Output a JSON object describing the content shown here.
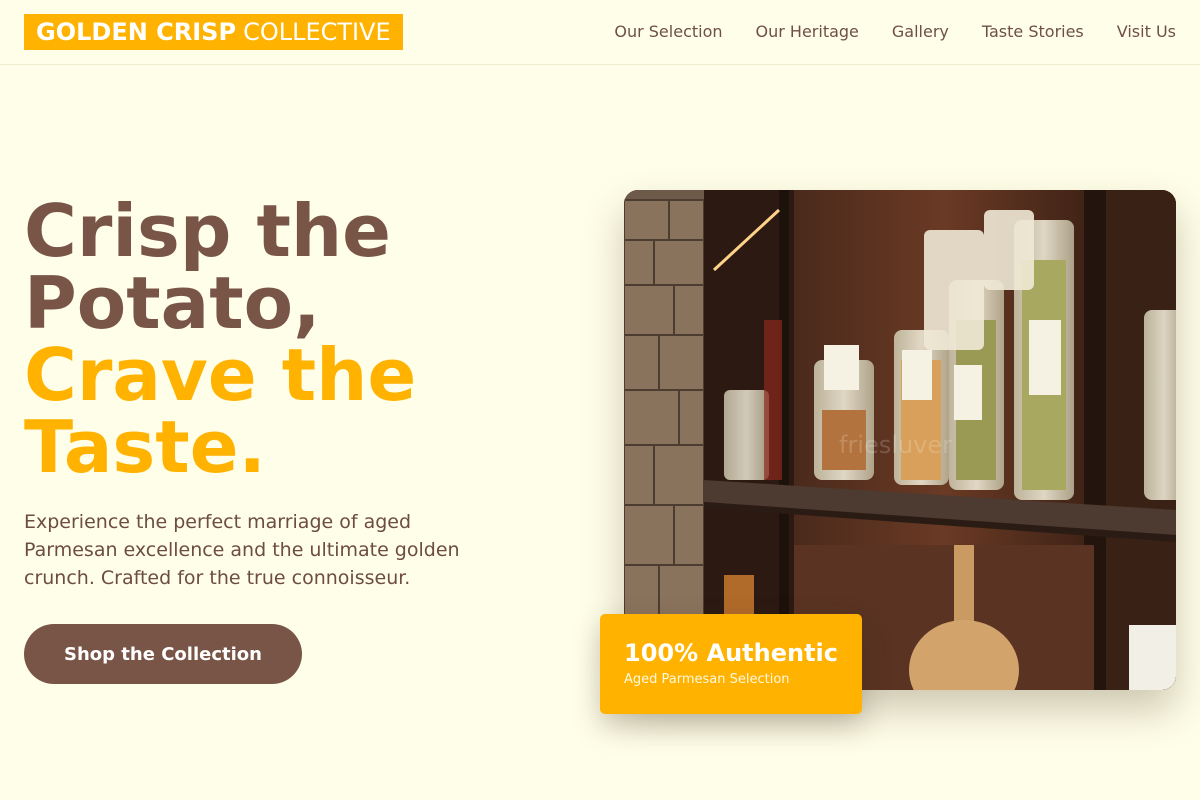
{
  "brand": {
    "name_bold": "GOLDEN CRISP",
    "name_light": "COLLECTIVE"
  },
  "nav": {
    "items": [
      {
        "label": "Our Selection"
      },
      {
        "label": "Our Heritage"
      },
      {
        "label": "Gallery"
      },
      {
        "label": "Taste Stories"
      },
      {
        "label": "Visit Us"
      }
    ]
  },
  "hero": {
    "title_lines": [
      "Crisp the",
      "Potato,"
    ],
    "title_accent_lines": [
      "Crave the",
      "Taste."
    ],
    "description": "Experience the perfect marriage of aged Parmesan excellence and the ultimate golden crunch. Crafted for the true connoisseur.",
    "cta_label": "Shop the Collection"
  },
  "photo": {
    "watermark": "friesluver"
  },
  "badge": {
    "title": "100% Authentic",
    "subtitle": "Aged Parmesan Selection"
  },
  "colors": {
    "accent": "#ffb300",
    "brown": "#795548",
    "background": "#fffee8"
  }
}
